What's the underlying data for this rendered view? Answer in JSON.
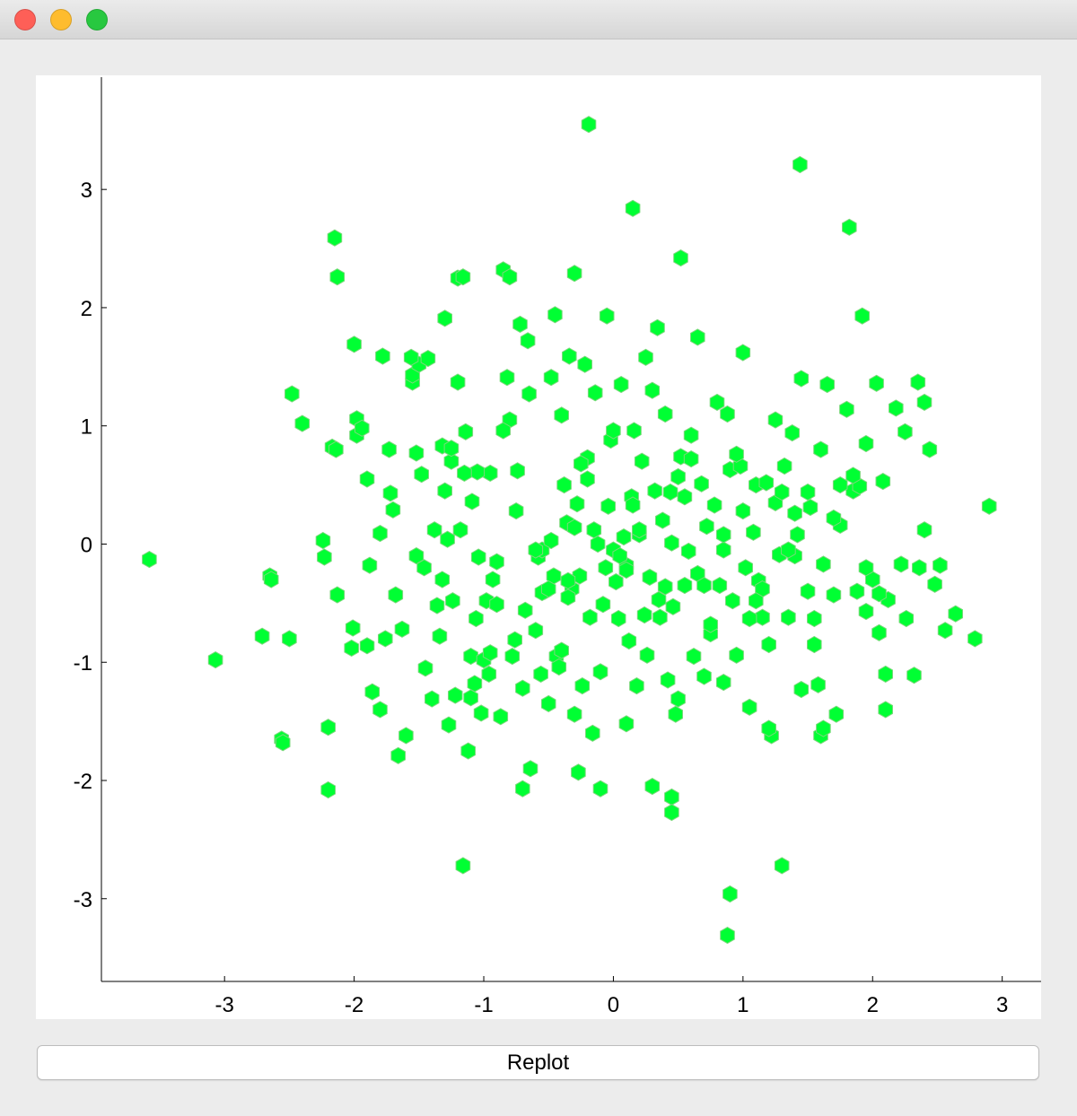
{
  "window": {
    "traffic_lights": {
      "close_color": "#fe5f57",
      "minimize_color": "#febc2e",
      "zoom_color": "#28c840"
    }
  },
  "colors": {
    "marker": "#00ff33",
    "marker_edge": "#7bd87b",
    "axis": "#000000",
    "plot_background": "#ffffff"
  },
  "chart_data": {
    "type": "scatter",
    "marker": "hexagon",
    "grid": false,
    "xlim": [
      -3.95,
      3.3
    ],
    "ylim": [
      -3.7,
      3.95
    ],
    "x_ticks": [
      -3,
      -2,
      -1,
      0,
      1,
      2,
      3
    ],
    "y_ticks": [
      -3,
      -2,
      -1,
      0,
      1,
      2,
      3
    ],
    "x_tick_labels": [
      "-3",
      "-2",
      "-1",
      "0",
      "1",
      "2",
      "3"
    ],
    "y_tick_labels": [
      "-3",
      "-2",
      "-1",
      "0",
      "1",
      "2",
      "3"
    ],
    "x": [
      -3.58,
      -3.07,
      -2.71,
      -2.65,
      -2.64,
      -2.56,
      -2.55,
      -2.5,
      -2.48,
      -2.4,
      -2.24,
      -2.23,
      -2.2,
      -2.17,
      -2.14,
      -2.13,
      -2.13,
      -2.02,
      -2.01,
      -2.0,
      -1.98,
      -1.98,
      -1.94,
      -1.9,
      -1.88,
      -1.86,
      -1.8,
      -1.78,
      -1.76,
      -1.73,
      -1.72,
      -1.7,
      -1.68,
      -1.66,
      -1.63,
      -1.6,
      -1.55,
      -1.55,
      -1.52,
      -1.52,
      -1.5,
      -1.48,
      -1.46,
      -1.43,
      -1.4,
      -1.38,
      -1.36,
      -1.34,
      -1.32,
      -1.3,
      -1.3,
      -1.28,
      -1.27,
      -1.25,
      -1.24,
      -1.22,
      -1.2,
      -1.18,
      -1.16,
      -1.14,
      -1.12,
      -1.1,
      -1.09,
      -1.07,
      -1.06,
      -1.04,
      -1.02,
      -1.0,
      -0.98,
      -0.96,
      -0.95,
      -0.93,
      -0.9,
      -0.87,
      -0.85,
      -0.82,
      -0.8,
      -0.78,
      -0.76,
      -0.74,
      -0.72,
      -0.7,
      -0.68,
      -0.66,
      -0.64,
      -0.6,
      -0.58,
      -0.56,
      -0.55,
      -0.53,
      -0.5,
      -0.48,
      -0.46,
      -0.44,
      -0.42,
      -0.4,
      -0.38,
      -0.36,
      -0.34,
      -0.32,
      -0.3,
      -0.28,
      -0.26,
      -0.24,
      -0.22,
      -0.2,
      -0.18,
      -0.16,
      -0.14,
      -0.12,
      -0.1,
      -0.08,
      -0.06,
      -0.04,
      -0.02,
      0.0,
      0.02,
      0.04,
      0.06,
      0.08,
      0.1,
      0.12,
      0.14,
      0.16,
      0.18,
      0.2,
      0.22,
      0.24,
      0.26,
      0.28,
      0.3,
      0.32,
      0.34,
      0.36,
      0.38,
      0.4,
      0.42,
      0.44,
      0.46,
      0.48,
      0.5,
      0.52,
      0.55,
      0.58,
      0.6,
      0.62,
      0.65,
      0.68,
      0.7,
      0.72,
      0.75,
      0.78,
      0.8,
      0.82,
      0.85,
      0.88,
      0.9,
      0.92,
      0.95,
      0.98,
      1.0,
      1.02,
      1.05,
      1.08,
      1.1,
      1.12,
      1.15,
      1.18,
      1.2,
      1.22,
      1.25,
      1.28,
      1.3,
      1.32,
      1.35,
      1.38,
      1.4,
      1.42,
      1.45,
      1.5,
      1.52,
      1.55,
      1.58,
      1.6,
      1.62,
      1.65,
      1.7,
      1.72,
      1.75,
      1.8,
      1.85,
      1.88,
      1.9,
      1.92,
      1.95,
      2.0,
      2.03,
      2.05,
      2.08,
      2.1,
      2.12,
      2.18,
      2.22,
      2.26,
      2.32,
      2.36,
      2.4,
      2.44,
      2.48,
      2.52,
      2.56,
      2.64,
      2.79,
      2.9,
      -0.48,
      -0.19,
      0.15,
      0.52,
      1.82,
      1.44,
      -2.15,
      -1.32,
      -0.8,
      -0.35,
      -0.1,
      0.3,
      0.45,
      0.9,
      1.3,
      1.6,
      -2.2,
      -1.9,
      -1.2,
      -0.85,
      -0.45,
      -0.05,
      0.25,
      0.65,
      1.0,
      1.45,
      1.95,
      2.35,
      -1.56,
      -1.1,
      -0.7,
      -0.3,
      0.1,
      0.5,
      0.85,
      1.2,
      1.62,
      2.1,
      -1.8,
      -1.45,
      -0.95,
      -0.55,
      -0.15,
      0.35,
      0.75,
      1.15,
      1.55,
      2.05,
      -1.25,
      -0.65,
      -0.25,
      0.2,
      0.6,
      1.05,
      1.5,
      1.95,
      -1.05,
      -0.5,
      0.0,
      0.45,
      0.95,
      1.4,
      1.85,
      2.4,
      -0.9,
      -0.4,
      0.05,
      0.55,
      1.1,
      1.7,
      2.25,
      -1.15,
      -0.6,
      -0.2,
      0.4,
      0.85,
      1.35,
      1.75,
      -0.75,
      -0.35,
      0.15,
      0.7,
      1.25,
      -0.3,
      0.1,
      0.88,
      -1.16,
      0.45,
      -0.27,
      0.07
    ],
    "y": [
      -0.13,
      -0.98,
      -0.78,
      -0.27,
      -0.3,
      -1.65,
      -1.68,
      -0.8,
      1.27,
      1.02,
      0.03,
      -0.11,
      -1.55,
      0.82,
      0.8,
      2.26,
      -0.43,
      -0.88,
      -0.71,
      1.69,
      1.06,
      0.92,
      0.98,
      0.55,
      -0.18,
      -1.25,
      0.09,
      1.59,
      -0.8,
      0.8,
      0.43,
      0.29,
      -0.43,
      -1.79,
      -0.72,
      -1.62,
      1.37,
      1.43,
      0.77,
      -0.1,
      1.52,
      0.59,
      -0.2,
      1.57,
      -1.31,
      0.12,
      -0.52,
      -0.78,
      -0.3,
      0.45,
      1.91,
      0.04,
      -1.53,
      0.7,
      -0.48,
      -1.28,
      2.25,
      0.12,
      2.26,
      0.95,
      -1.75,
      -0.95,
      0.36,
      -1.18,
      -0.63,
      -0.11,
      -1.43,
      -0.98,
      -0.48,
      -1.1,
      0.6,
      -0.3,
      -0.51,
      -1.46,
      2.32,
      1.41,
      1.05,
      -0.95,
      -0.81,
      0.62,
      1.86,
      -1.22,
      -0.56,
      1.72,
      -1.9,
      -0.73,
      -0.11,
      -1.1,
      -0.05,
      -0.4,
      -1.35,
      0.03,
      -0.27,
      -0.95,
      -1.04,
      -0.9,
      0.5,
      0.18,
      1.59,
      -0.38,
      2.29,
      0.34,
      -0.27,
      -1.2,
      1.52,
      0.73,
      -0.62,
      -1.6,
      1.28,
      0.0,
      -1.08,
      -0.51,
      -0.2,
      0.32,
      0.88,
      -0.05,
      -0.32,
      -0.63,
      1.35,
      0.06,
      -0.18,
      -0.82,
      0.4,
      0.96,
      -1.2,
      0.08,
      0.7,
      -0.6,
      -0.94,
      -0.28,
      1.3,
      0.45,
      1.83,
      -0.62,
      0.2,
      1.1,
      -1.15,
      0.44,
      -0.53,
      -1.44,
      0.57,
      0.74,
      -0.35,
      -0.06,
      0.92,
      -0.95,
      -0.25,
      0.51,
      -1.12,
      0.15,
      -0.76,
      0.33,
      1.2,
      -0.35,
      -0.05,
      1.1,
      0.63,
      -0.48,
      -0.94,
      0.66,
      0.28,
      -0.2,
      -1.38,
      0.1,
      0.5,
      -0.31,
      -0.62,
      0.52,
      -0.85,
      -1.62,
      0.35,
      -0.09,
      0.44,
      0.66,
      -0.62,
      0.94,
      -0.1,
      0.08,
      -1.23,
      -0.4,
      0.31,
      -0.63,
      -1.19,
      0.8,
      -0.17,
      1.35,
      -0.43,
      -1.44,
      0.16,
      1.14,
      0.45,
      -0.4,
      0.49,
      1.93,
      -0.57,
      -0.3,
      1.36,
      -0.75,
      0.53,
      -1.4,
      -0.47,
      1.15,
      -0.17,
      -0.63,
      -1.11,
      -0.2,
      0.12,
      0.8,
      -0.34,
      -0.18,
      -0.73,
      -0.59,
      -0.8,
      0.32,
      1.41,
      3.55,
      2.84,
      2.42,
      2.68,
      3.21,
      2.59,
      0.83,
      2.26,
      -0.45,
      -2.07,
      -2.05,
      -2.14,
      -2.96,
      -2.72,
      -1.62,
      -2.08,
      -0.86,
      1.37,
      0.96,
      1.94,
      1.93,
      1.58,
      1.75,
      1.62,
      1.4,
      0.85,
      1.37,
      1.58,
      -1.3,
      -2.07,
      -1.44,
      -1.52,
      -1.31,
      -1.17,
      -1.56,
      -1.56,
      -1.1,
      -1.4,
      -1.05,
      -0.92,
      -0.41,
      0.12,
      -0.47,
      -0.68,
      -0.38,
      -0.85,
      -0.42,
      0.81,
      1.27,
      0.68,
      0.12,
      0.72,
      -0.63,
      0.44,
      -0.2,
      0.61,
      -0.38,
      0.96,
      0.01,
      0.76,
      0.26,
      0.58,
      1.2,
      -0.15,
      1.09,
      -0.1,
      0.4,
      -0.48,
      0.22,
      0.95,
      0.6,
      -0.05,
      0.55,
      -0.36,
      0.08,
      -0.05,
      0.5,
      0.28,
      -0.31,
      0.33,
      -0.35,
      1.05,
      0.14,
      -0.22,
      -3.31,
      -2.72,
      -2.27,
      -1.93
    ]
  }
}
